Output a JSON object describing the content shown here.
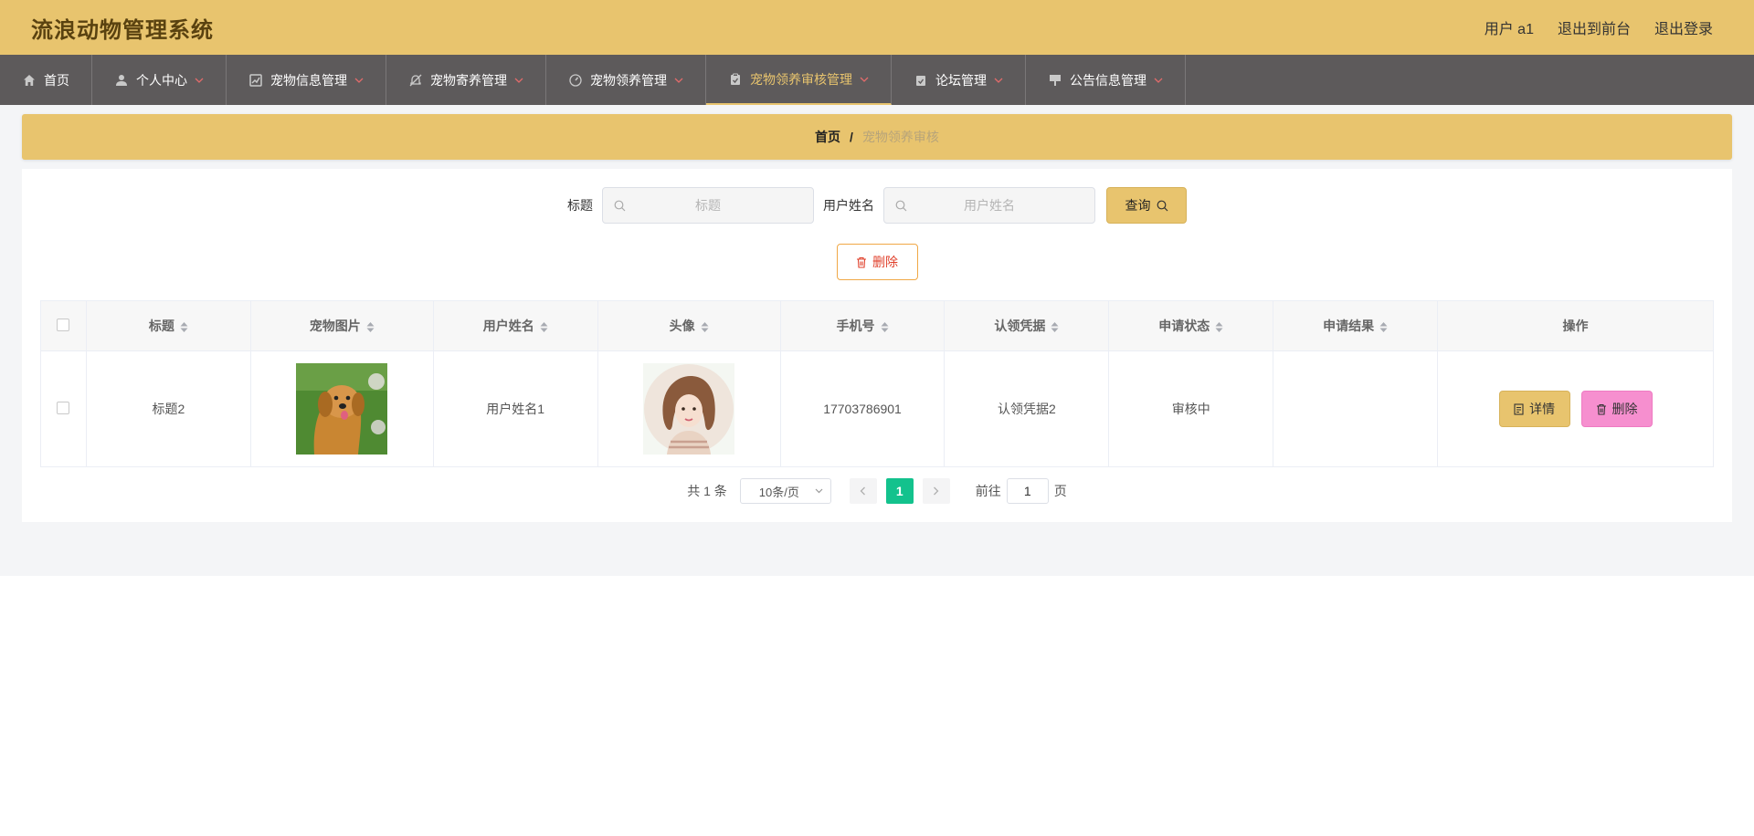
{
  "app": {
    "title": "流浪动物管理系统"
  },
  "topbar": {
    "user_label": "用户 a1",
    "to_front": "退出到前台",
    "logout": "退出登录"
  },
  "nav": [
    {
      "label": "首页",
      "icon": "home-icon",
      "has_dropdown": false
    },
    {
      "label": "个人中心",
      "icon": "user-icon",
      "has_dropdown": true
    },
    {
      "label": "宠物信息管理",
      "icon": "chart-icon",
      "has_dropdown": true
    },
    {
      "label": "宠物寄养管理",
      "icon": "bell-off-icon",
      "has_dropdown": true
    },
    {
      "label": "宠物领养管理",
      "icon": "gauge-icon",
      "has_dropdown": true
    },
    {
      "label": "宠物领养审核管理",
      "icon": "clipboard-icon",
      "has_dropdown": true,
      "active": true
    },
    {
      "label": "论坛管理",
      "icon": "clipboard-check-icon",
      "has_dropdown": true
    },
    {
      "label": "公告信息管理",
      "icon": "sign-icon",
      "has_dropdown": true
    }
  ],
  "breadcrumb": {
    "home": "首页",
    "separator": "/",
    "current": "宠物领养审核"
  },
  "search": {
    "title_label": "标题",
    "title_placeholder": "标题",
    "title_value": "",
    "username_label": "用户姓名",
    "username_placeholder": "用户姓名",
    "username_value": "",
    "query_label": "查询"
  },
  "actions": {
    "delete_label": "删除"
  },
  "table": {
    "headers": [
      "标题",
      "宠物图片",
      "用户姓名",
      "头像",
      "手机号",
      "认领凭据",
      "申请状态",
      "申请结果",
      "操作"
    ],
    "rows": [
      {
        "title": "标题2",
        "pet_image": "dog-photo",
        "username": "用户姓名1",
        "avatar": "girl-avatar",
        "phone": "17703786901",
        "credential": "认领凭据2",
        "status": "审核中",
        "result": ""
      }
    ],
    "row_actions": {
      "detail_label": "详情",
      "delete_label": "删除"
    }
  },
  "pagination": {
    "total_text": "共 1 条",
    "page_size": "10条/页",
    "current_page": "1",
    "goto_label": "前往",
    "goto_value": "1",
    "page_suffix": "页"
  },
  "colors": {
    "topbar": "#e8c46e",
    "nav_bg": "#5d5a5b",
    "accent_green": "#13c28d",
    "delete_pink": "#f68fcf"
  }
}
